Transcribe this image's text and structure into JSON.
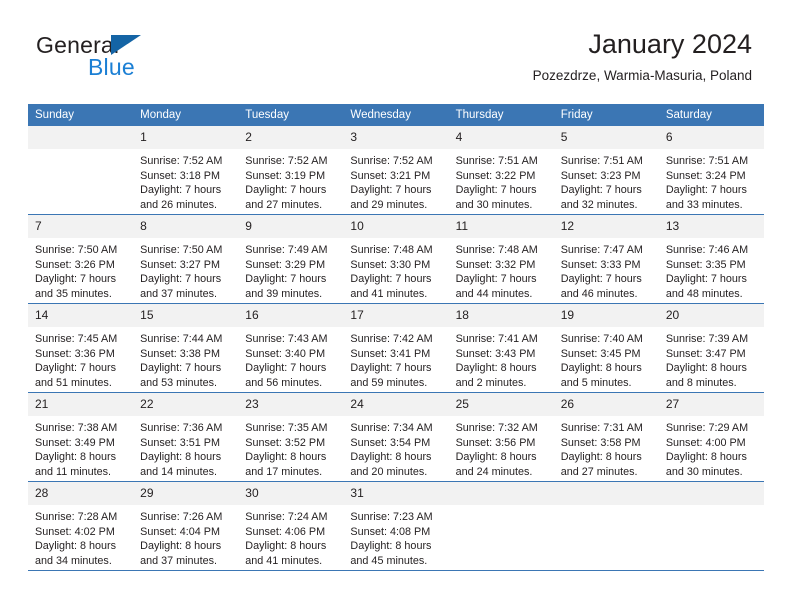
{
  "brand": {
    "name_part1": "General",
    "name_part2": "Blue",
    "accent_color": "#1b7fd4",
    "triangle_color": "#1464a5"
  },
  "header": {
    "title": "January 2024",
    "subtitle": "Pozezdrze, Warmia-Masuria, Poland"
  },
  "calendar": {
    "header_color": "#3b76b4",
    "daynum_background": "#f2f2f2",
    "weekday_headers": [
      "Sunday",
      "Monday",
      "Tuesday",
      "Wednesday",
      "Thursday",
      "Friday",
      "Saturday"
    ],
    "weeks": [
      [
        {
          "day": "",
          "sunrise": "",
          "sunset": "",
          "daylight1": "",
          "daylight2": ""
        },
        {
          "day": "1",
          "sunrise": "Sunrise: 7:52 AM",
          "sunset": "Sunset: 3:18 PM",
          "daylight1": "Daylight: 7 hours",
          "daylight2": "and 26 minutes."
        },
        {
          "day": "2",
          "sunrise": "Sunrise: 7:52 AM",
          "sunset": "Sunset: 3:19 PM",
          "daylight1": "Daylight: 7 hours",
          "daylight2": "and 27 minutes."
        },
        {
          "day": "3",
          "sunrise": "Sunrise: 7:52 AM",
          "sunset": "Sunset: 3:21 PM",
          "daylight1": "Daylight: 7 hours",
          "daylight2": "and 29 minutes."
        },
        {
          "day": "4",
          "sunrise": "Sunrise: 7:51 AM",
          "sunset": "Sunset: 3:22 PM",
          "daylight1": "Daylight: 7 hours",
          "daylight2": "and 30 minutes."
        },
        {
          "day": "5",
          "sunrise": "Sunrise: 7:51 AM",
          "sunset": "Sunset: 3:23 PM",
          "daylight1": "Daylight: 7 hours",
          "daylight2": "and 32 minutes."
        },
        {
          "day": "6",
          "sunrise": "Sunrise: 7:51 AM",
          "sunset": "Sunset: 3:24 PM",
          "daylight1": "Daylight: 7 hours",
          "daylight2": "and 33 minutes."
        }
      ],
      [
        {
          "day": "7",
          "sunrise": "Sunrise: 7:50 AM",
          "sunset": "Sunset: 3:26 PM",
          "daylight1": "Daylight: 7 hours",
          "daylight2": "and 35 minutes."
        },
        {
          "day": "8",
          "sunrise": "Sunrise: 7:50 AM",
          "sunset": "Sunset: 3:27 PM",
          "daylight1": "Daylight: 7 hours",
          "daylight2": "and 37 minutes."
        },
        {
          "day": "9",
          "sunrise": "Sunrise: 7:49 AM",
          "sunset": "Sunset: 3:29 PM",
          "daylight1": "Daylight: 7 hours",
          "daylight2": "and 39 minutes."
        },
        {
          "day": "10",
          "sunrise": "Sunrise: 7:48 AM",
          "sunset": "Sunset: 3:30 PM",
          "daylight1": "Daylight: 7 hours",
          "daylight2": "and 41 minutes."
        },
        {
          "day": "11",
          "sunrise": "Sunrise: 7:48 AM",
          "sunset": "Sunset: 3:32 PM",
          "daylight1": "Daylight: 7 hours",
          "daylight2": "and 44 minutes."
        },
        {
          "day": "12",
          "sunrise": "Sunrise: 7:47 AM",
          "sunset": "Sunset: 3:33 PM",
          "daylight1": "Daylight: 7 hours",
          "daylight2": "and 46 minutes."
        },
        {
          "day": "13",
          "sunrise": "Sunrise: 7:46 AM",
          "sunset": "Sunset: 3:35 PM",
          "daylight1": "Daylight: 7 hours",
          "daylight2": "and 48 minutes."
        }
      ],
      [
        {
          "day": "14",
          "sunrise": "Sunrise: 7:45 AM",
          "sunset": "Sunset: 3:36 PM",
          "daylight1": "Daylight: 7 hours",
          "daylight2": "and 51 minutes."
        },
        {
          "day": "15",
          "sunrise": "Sunrise: 7:44 AM",
          "sunset": "Sunset: 3:38 PM",
          "daylight1": "Daylight: 7 hours",
          "daylight2": "and 53 minutes."
        },
        {
          "day": "16",
          "sunrise": "Sunrise: 7:43 AM",
          "sunset": "Sunset: 3:40 PM",
          "daylight1": "Daylight: 7 hours",
          "daylight2": "and 56 minutes."
        },
        {
          "day": "17",
          "sunrise": "Sunrise: 7:42 AM",
          "sunset": "Sunset: 3:41 PM",
          "daylight1": "Daylight: 7 hours",
          "daylight2": "and 59 minutes."
        },
        {
          "day": "18",
          "sunrise": "Sunrise: 7:41 AM",
          "sunset": "Sunset: 3:43 PM",
          "daylight1": "Daylight: 8 hours",
          "daylight2": "and 2 minutes."
        },
        {
          "day": "19",
          "sunrise": "Sunrise: 7:40 AM",
          "sunset": "Sunset: 3:45 PM",
          "daylight1": "Daylight: 8 hours",
          "daylight2": "and 5 minutes."
        },
        {
          "day": "20",
          "sunrise": "Sunrise: 7:39 AM",
          "sunset": "Sunset: 3:47 PM",
          "daylight1": "Daylight: 8 hours",
          "daylight2": "and 8 minutes."
        }
      ],
      [
        {
          "day": "21",
          "sunrise": "Sunrise: 7:38 AM",
          "sunset": "Sunset: 3:49 PM",
          "daylight1": "Daylight: 8 hours",
          "daylight2": "and 11 minutes."
        },
        {
          "day": "22",
          "sunrise": "Sunrise: 7:36 AM",
          "sunset": "Sunset: 3:51 PM",
          "daylight1": "Daylight: 8 hours",
          "daylight2": "and 14 minutes."
        },
        {
          "day": "23",
          "sunrise": "Sunrise: 7:35 AM",
          "sunset": "Sunset: 3:52 PM",
          "daylight1": "Daylight: 8 hours",
          "daylight2": "and 17 minutes."
        },
        {
          "day": "24",
          "sunrise": "Sunrise: 7:34 AM",
          "sunset": "Sunset: 3:54 PM",
          "daylight1": "Daylight: 8 hours",
          "daylight2": "and 20 minutes."
        },
        {
          "day": "25",
          "sunrise": "Sunrise: 7:32 AM",
          "sunset": "Sunset: 3:56 PM",
          "daylight1": "Daylight: 8 hours",
          "daylight2": "and 24 minutes."
        },
        {
          "day": "26",
          "sunrise": "Sunrise: 7:31 AM",
          "sunset": "Sunset: 3:58 PM",
          "daylight1": "Daylight: 8 hours",
          "daylight2": "and 27 minutes."
        },
        {
          "day": "27",
          "sunrise": "Sunrise: 7:29 AM",
          "sunset": "Sunset: 4:00 PM",
          "daylight1": "Daylight: 8 hours",
          "daylight2": "and 30 minutes."
        }
      ],
      [
        {
          "day": "28",
          "sunrise": "Sunrise: 7:28 AM",
          "sunset": "Sunset: 4:02 PM",
          "daylight1": "Daylight: 8 hours",
          "daylight2": "and 34 minutes."
        },
        {
          "day": "29",
          "sunrise": "Sunrise: 7:26 AM",
          "sunset": "Sunset: 4:04 PM",
          "daylight1": "Daylight: 8 hours",
          "daylight2": "and 37 minutes."
        },
        {
          "day": "30",
          "sunrise": "Sunrise: 7:24 AM",
          "sunset": "Sunset: 4:06 PM",
          "daylight1": "Daylight: 8 hours",
          "daylight2": "and 41 minutes."
        },
        {
          "day": "31",
          "sunrise": "Sunrise: 7:23 AM",
          "sunset": "Sunset: 4:08 PM",
          "daylight1": "Daylight: 8 hours",
          "daylight2": "and 45 minutes."
        },
        {
          "day": "",
          "sunrise": "",
          "sunset": "",
          "daylight1": "",
          "daylight2": ""
        },
        {
          "day": "",
          "sunrise": "",
          "sunset": "",
          "daylight1": "",
          "daylight2": ""
        },
        {
          "day": "",
          "sunrise": "",
          "sunset": "",
          "daylight1": "",
          "daylight2": ""
        }
      ]
    ]
  }
}
